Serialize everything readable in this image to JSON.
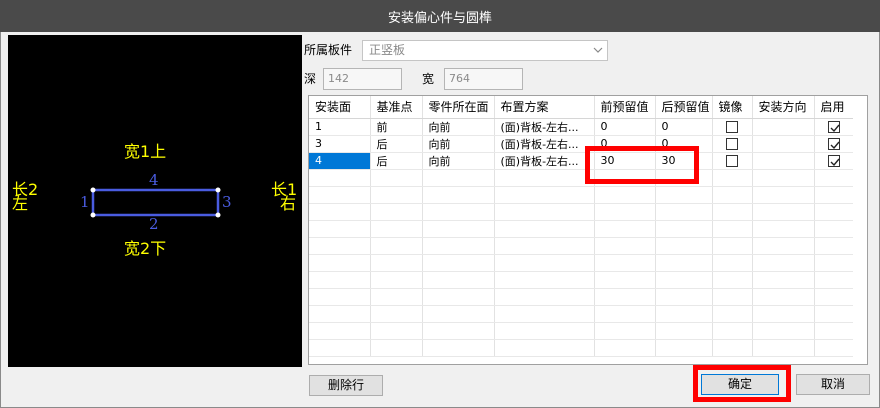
{
  "window": {
    "title": "安装偏心件与圆榫"
  },
  "preview": {
    "top_label": "宽1上",
    "bottom_label": "宽2下",
    "left_label_top": "长2",
    "left_label_bottom": "左",
    "right_label_top": "长1",
    "right_label_bottom": "右",
    "edge_top": "4",
    "edge_bottom": "2",
    "edge_left": "1",
    "edge_right": "3",
    "colors": {
      "text": "#ffff00",
      "outline": "#4a5ce0",
      "background": "#000000"
    }
  },
  "form": {
    "board_label": "所属板件",
    "board_value": "正竖板",
    "depth_label": "深",
    "depth_value": "142",
    "width_label": "宽",
    "width_value": "764"
  },
  "table": {
    "columns": [
      "安装面",
      "基准点",
      "零件所在面",
      "布置方案",
      "前预留值",
      "后预留值",
      "镜像",
      "安装方向",
      "启用"
    ],
    "rows": [
      {
        "face": "1",
        "ref": "前",
        "part_face": "向前",
        "plan": "(面)背板-左右...",
        "front": "0",
        "back": "0",
        "mirror": false,
        "direction": "",
        "enabled": true,
        "selected": false
      },
      {
        "face": "3",
        "ref": "后",
        "part_face": "向前",
        "plan": "(面)背板-左右...",
        "front": "0",
        "back": "0",
        "mirror": false,
        "direction": "",
        "enabled": true,
        "selected": false
      },
      {
        "face": "4",
        "ref": "后",
        "part_face": "向前",
        "plan": "(面)背板-左右...",
        "front": "30",
        "back": "30",
        "mirror": false,
        "direction": "",
        "enabled": true,
        "selected": true
      }
    ]
  },
  "buttons": {
    "delete_row": "删除行",
    "ok": "确定",
    "cancel": "取消"
  },
  "colors": {
    "highlight": "#ff0000",
    "selection": "#0078d7",
    "titlebar": "#4a4a4a"
  }
}
